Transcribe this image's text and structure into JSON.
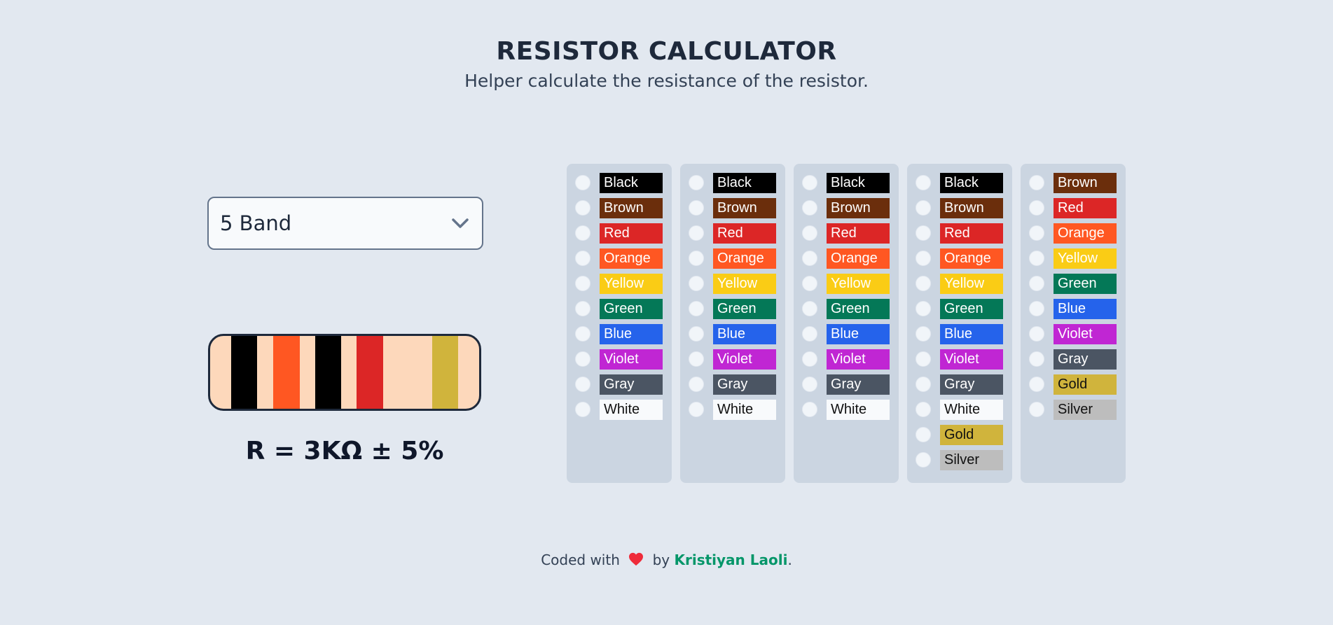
{
  "header": {
    "title": "RESISTOR CALCULATOR",
    "subtitle": "Helper calculate the resistance of the resistor."
  },
  "band_select": {
    "selected": "5 Band",
    "icon": "chevron-down-icon"
  },
  "resistor": {
    "body_color": "#fdd8bb",
    "bands": [
      {
        "name": "Black",
        "color": "#000000"
      },
      {
        "name": "Orange",
        "color": "#ff5722"
      },
      {
        "name": "Black",
        "color": "#000000"
      },
      {
        "name": "Red",
        "color": "#dc2626"
      },
      {
        "name": "Gold",
        "color": "#d0b43c"
      }
    ]
  },
  "result": "R = 3KΩ ± 5%",
  "columns": [
    {
      "options": [
        "Black",
        "Brown",
        "Red",
        "Orange",
        "Yellow",
        "Green",
        "Blue",
        "Violet",
        "Gray",
        "White"
      ]
    },
    {
      "options": [
        "Black",
        "Brown",
        "Red",
        "Orange",
        "Yellow",
        "Green",
        "Blue",
        "Violet",
        "Gray",
        "White"
      ]
    },
    {
      "options": [
        "Black",
        "Brown",
        "Red",
        "Orange",
        "Yellow",
        "Green",
        "Blue",
        "Violet",
        "Gray",
        "White"
      ]
    },
    {
      "options": [
        "Black",
        "Brown",
        "Red",
        "Orange",
        "Yellow",
        "Green",
        "Blue",
        "Violet",
        "Gray",
        "White",
        "Gold",
        "Silver"
      ]
    },
    {
      "options": [
        "Brown",
        "Red",
        "Orange",
        "Yellow",
        "Green",
        "Blue",
        "Violet",
        "Gray",
        "Gold",
        "Silver"
      ]
    }
  ],
  "colors": {
    "Black": {
      "bg": "#000000",
      "fg": "#ffffff"
    },
    "Brown": {
      "bg": "#6b2e0c",
      "fg": "#ffffff"
    },
    "Red": {
      "bg": "#dc2626",
      "fg": "#ffffff"
    },
    "Orange": {
      "bg": "#ff5722",
      "fg": "#ffffff"
    },
    "Yellow": {
      "bg": "#facc15",
      "fg": "#ffffff"
    },
    "Green": {
      "bg": "#047857",
      "fg": "#ffffff"
    },
    "Blue": {
      "bg": "#2563eb",
      "fg": "#ffffff"
    },
    "Violet": {
      "bg": "#c026d3",
      "fg": "#ffffff"
    },
    "Gray": {
      "bg": "#4b5563",
      "fg": "#ffffff"
    },
    "White": {
      "bg": "#f8fafc",
      "fg": "#111111"
    },
    "Gold": {
      "bg": "#d0b43c",
      "fg": "#111111"
    },
    "Silver": {
      "bg": "#bdbdbd",
      "fg": "#111111"
    }
  },
  "footer": {
    "prefix": "Coded with",
    "heart_icon": "heart-icon",
    "by": "by",
    "author": "Kristiyan Laoli",
    "suffix": "."
  }
}
